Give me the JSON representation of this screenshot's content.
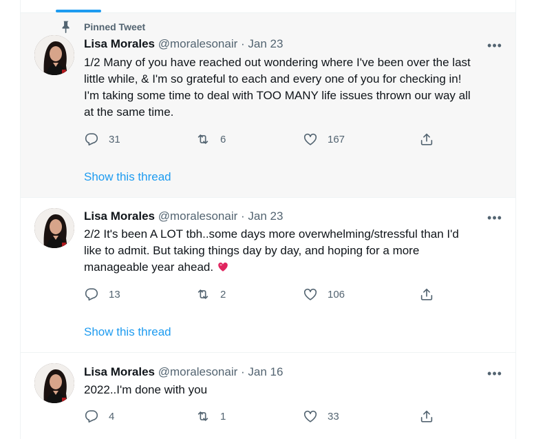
{
  "colors": {
    "accent": "#1d9bf0",
    "muted": "#536471",
    "text": "#0f1419",
    "heart_emoji": "#e0245e"
  },
  "tweets": [
    {
      "pinned_label": "Pinned Tweet",
      "name": "Lisa Morales",
      "handle": "@moralesonair",
      "separator": "·",
      "date": "Jan 23",
      "more": "•••",
      "lines": [
        "1/2 Many of you have reached out wondering where I've been over the last",
        "little while, & I'm so grateful to each and every one of you for checking in!",
        "I'm taking some time to deal with TOO MANY life issues thrown our way all",
        "at the same time."
      ],
      "replies": "31",
      "retweets": "6",
      "likes": "167",
      "show_thread": "Show this thread"
    },
    {
      "name": "Lisa Morales",
      "handle": "@moralesonair",
      "separator": "·",
      "date": "Jan 23",
      "more": "•••",
      "lines": [
        "2/2 It's been A LOT tbh..some days more overwhelming/stressful than I'd",
        "like to admit.  But taking things day by day, and hoping for a more",
        "manageable year ahead."
      ],
      "replies": "13",
      "retweets": "2",
      "likes": "106",
      "show_thread": "Show this thread"
    },
    {
      "name": "Lisa Morales",
      "handle": "@moralesonair",
      "separator": "·",
      "date": "Jan 16",
      "more": "•••",
      "lines": [
        "2022..I'm done with you"
      ],
      "replies": "4",
      "retweets": "1",
      "likes": "33"
    }
  ],
  "icons": [
    "pin-icon",
    "reply-icon",
    "retweet-icon",
    "like-icon",
    "share-icon",
    "more-icon",
    "heart-emoji-icon"
  ]
}
